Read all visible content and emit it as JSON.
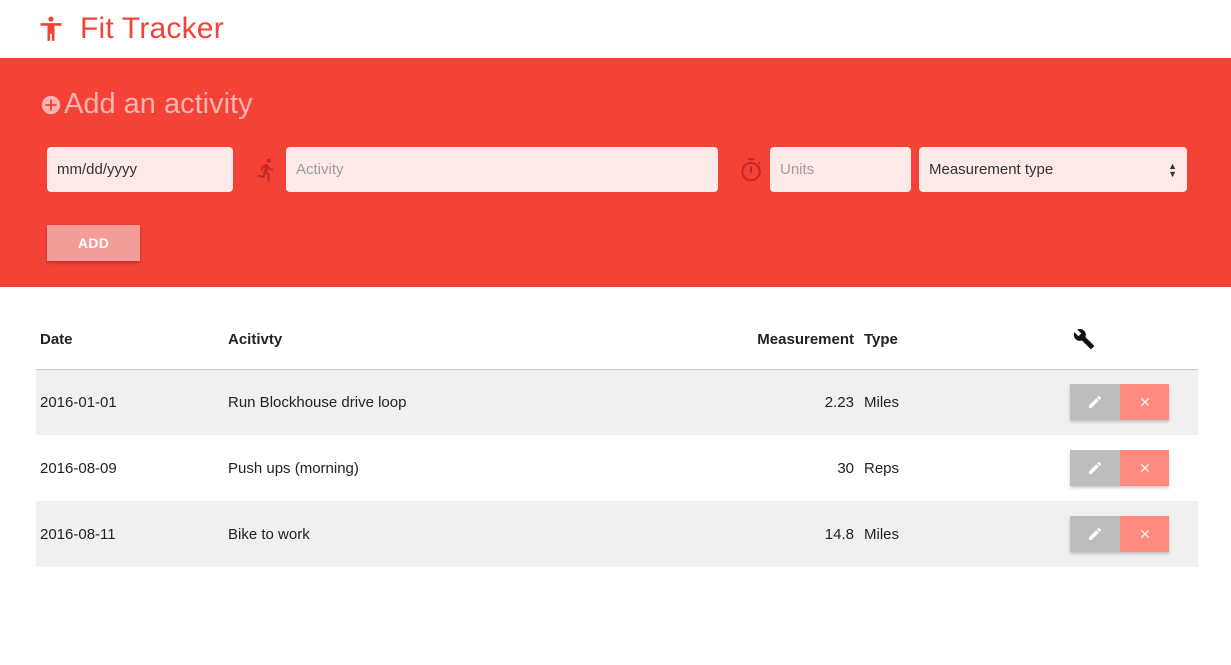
{
  "header": {
    "title": "Fit Tracker",
    "logo_icon": "accessibility-icon",
    "brand_color": "#f44336"
  },
  "form": {
    "heading": "Add an activity",
    "heading_icon": "add-circle-icon",
    "date_placeholder": "mm/dd/yyyy",
    "activity_placeholder": "Activity",
    "activity_icon": "directions-run-icon",
    "units_placeholder": "Units",
    "units_icon": "timer-icon",
    "measurement_select": "Measurement type",
    "add_label": "ADD"
  },
  "table": {
    "headers": {
      "date": "Date",
      "activity": "Acitivty",
      "measurement": "Measurement",
      "type": "Type",
      "actions_icon": "wrench-icon"
    },
    "rows": [
      {
        "date": "2016-01-01",
        "activity": "Run Blockhouse drive loop",
        "measurement": "2.23",
        "type": "Miles"
      },
      {
        "date": "2016-08-09",
        "activity": "Push ups (morning)",
        "measurement": "30",
        "type": "Reps"
      },
      {
        "date": "2016-08-11",
        "activity": "Bike to work",
        "measurement": "14.8",
        "type": "Miles"
      }
    ],
    "row_actions": {
      "edit_icon": "pencil-icon",
      "delete_icon": "close-icon"
    }
  }
}
